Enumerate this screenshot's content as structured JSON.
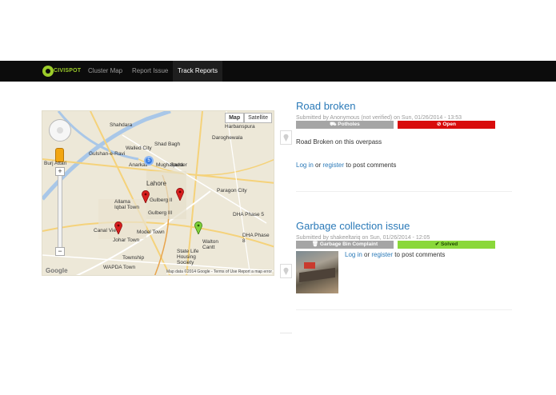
{
  "brand": {
    "logo_text": "CIVISPOT"
  },
  "nav": {
    "items": [
      {
        "label": "Cluster Map"
      },
      {
        "label": "Report Issue"
      },
      {
        "label": "Track Reports",
        "active": true
      }
    ]
  },
  "map": {
    "type_buttons": [
      "Map",
      "Satellite"
    ],
    "labels": [
      "Shahdara",
      "Walled City",
      "Shad Bagh",
      "Anarkali",
      "Mughalpura",
      "Lahore",
      "Gulberg II",
      "Gulberg III",
      "Allama Iqbal Town",
      "Model Town",
      "Johar Town",
      "Township",
      "WAPDA Town",
      "Walton Cantt",
      "DHA Phase 8",
      "Daroghewala",
      "Harbanspura",
      "Canal View",
      "Sadder",
      "Gulshan-e-Ravi",
      "Burj Attari",
      "Paragon City",
      "DHA Phase 5",
      "State Life Housing Society"
    ],
    "cluster_count": "5",
    "footer": "Map data ©2014 Google - Terms of Use   Report a map error",
    "google_logo": "Google"
  },
  "posts": [
    {
      "title": "Road broken",
      "meta": "Submitted by Anonymous (not verified) on Sun, 01/26/2014 - 13:53",
      "category": "Potholes",
      "status": "Open",
      "status_color": "#d80c0c",
      "body": "Road Broken on this overpass",
      "login_label": "Log in",
      "or_label": " or ",
      "register_label": "register",
      "suffix_label": " to post comments"
    },
    {
      "title": "Garbage collection issue",
      "meta": "Submitted by shakeeltariq on Sun, 01/26/2014 - 12:05",
      "category": "Garbage Bin Complaint",
      "status": "Solved",
      "status_color": "#8ad83a",
      "login_label": "Log in",
      "or_label": " or ",
      "register_label": "register",
      "suffix_label": " to post comments"
    }
  ],
  "colors": {
    "link": "#2b7ab8",
    "navbar": "#0c0c0c",
    "accent": "#9ccc2a"
  }
}
